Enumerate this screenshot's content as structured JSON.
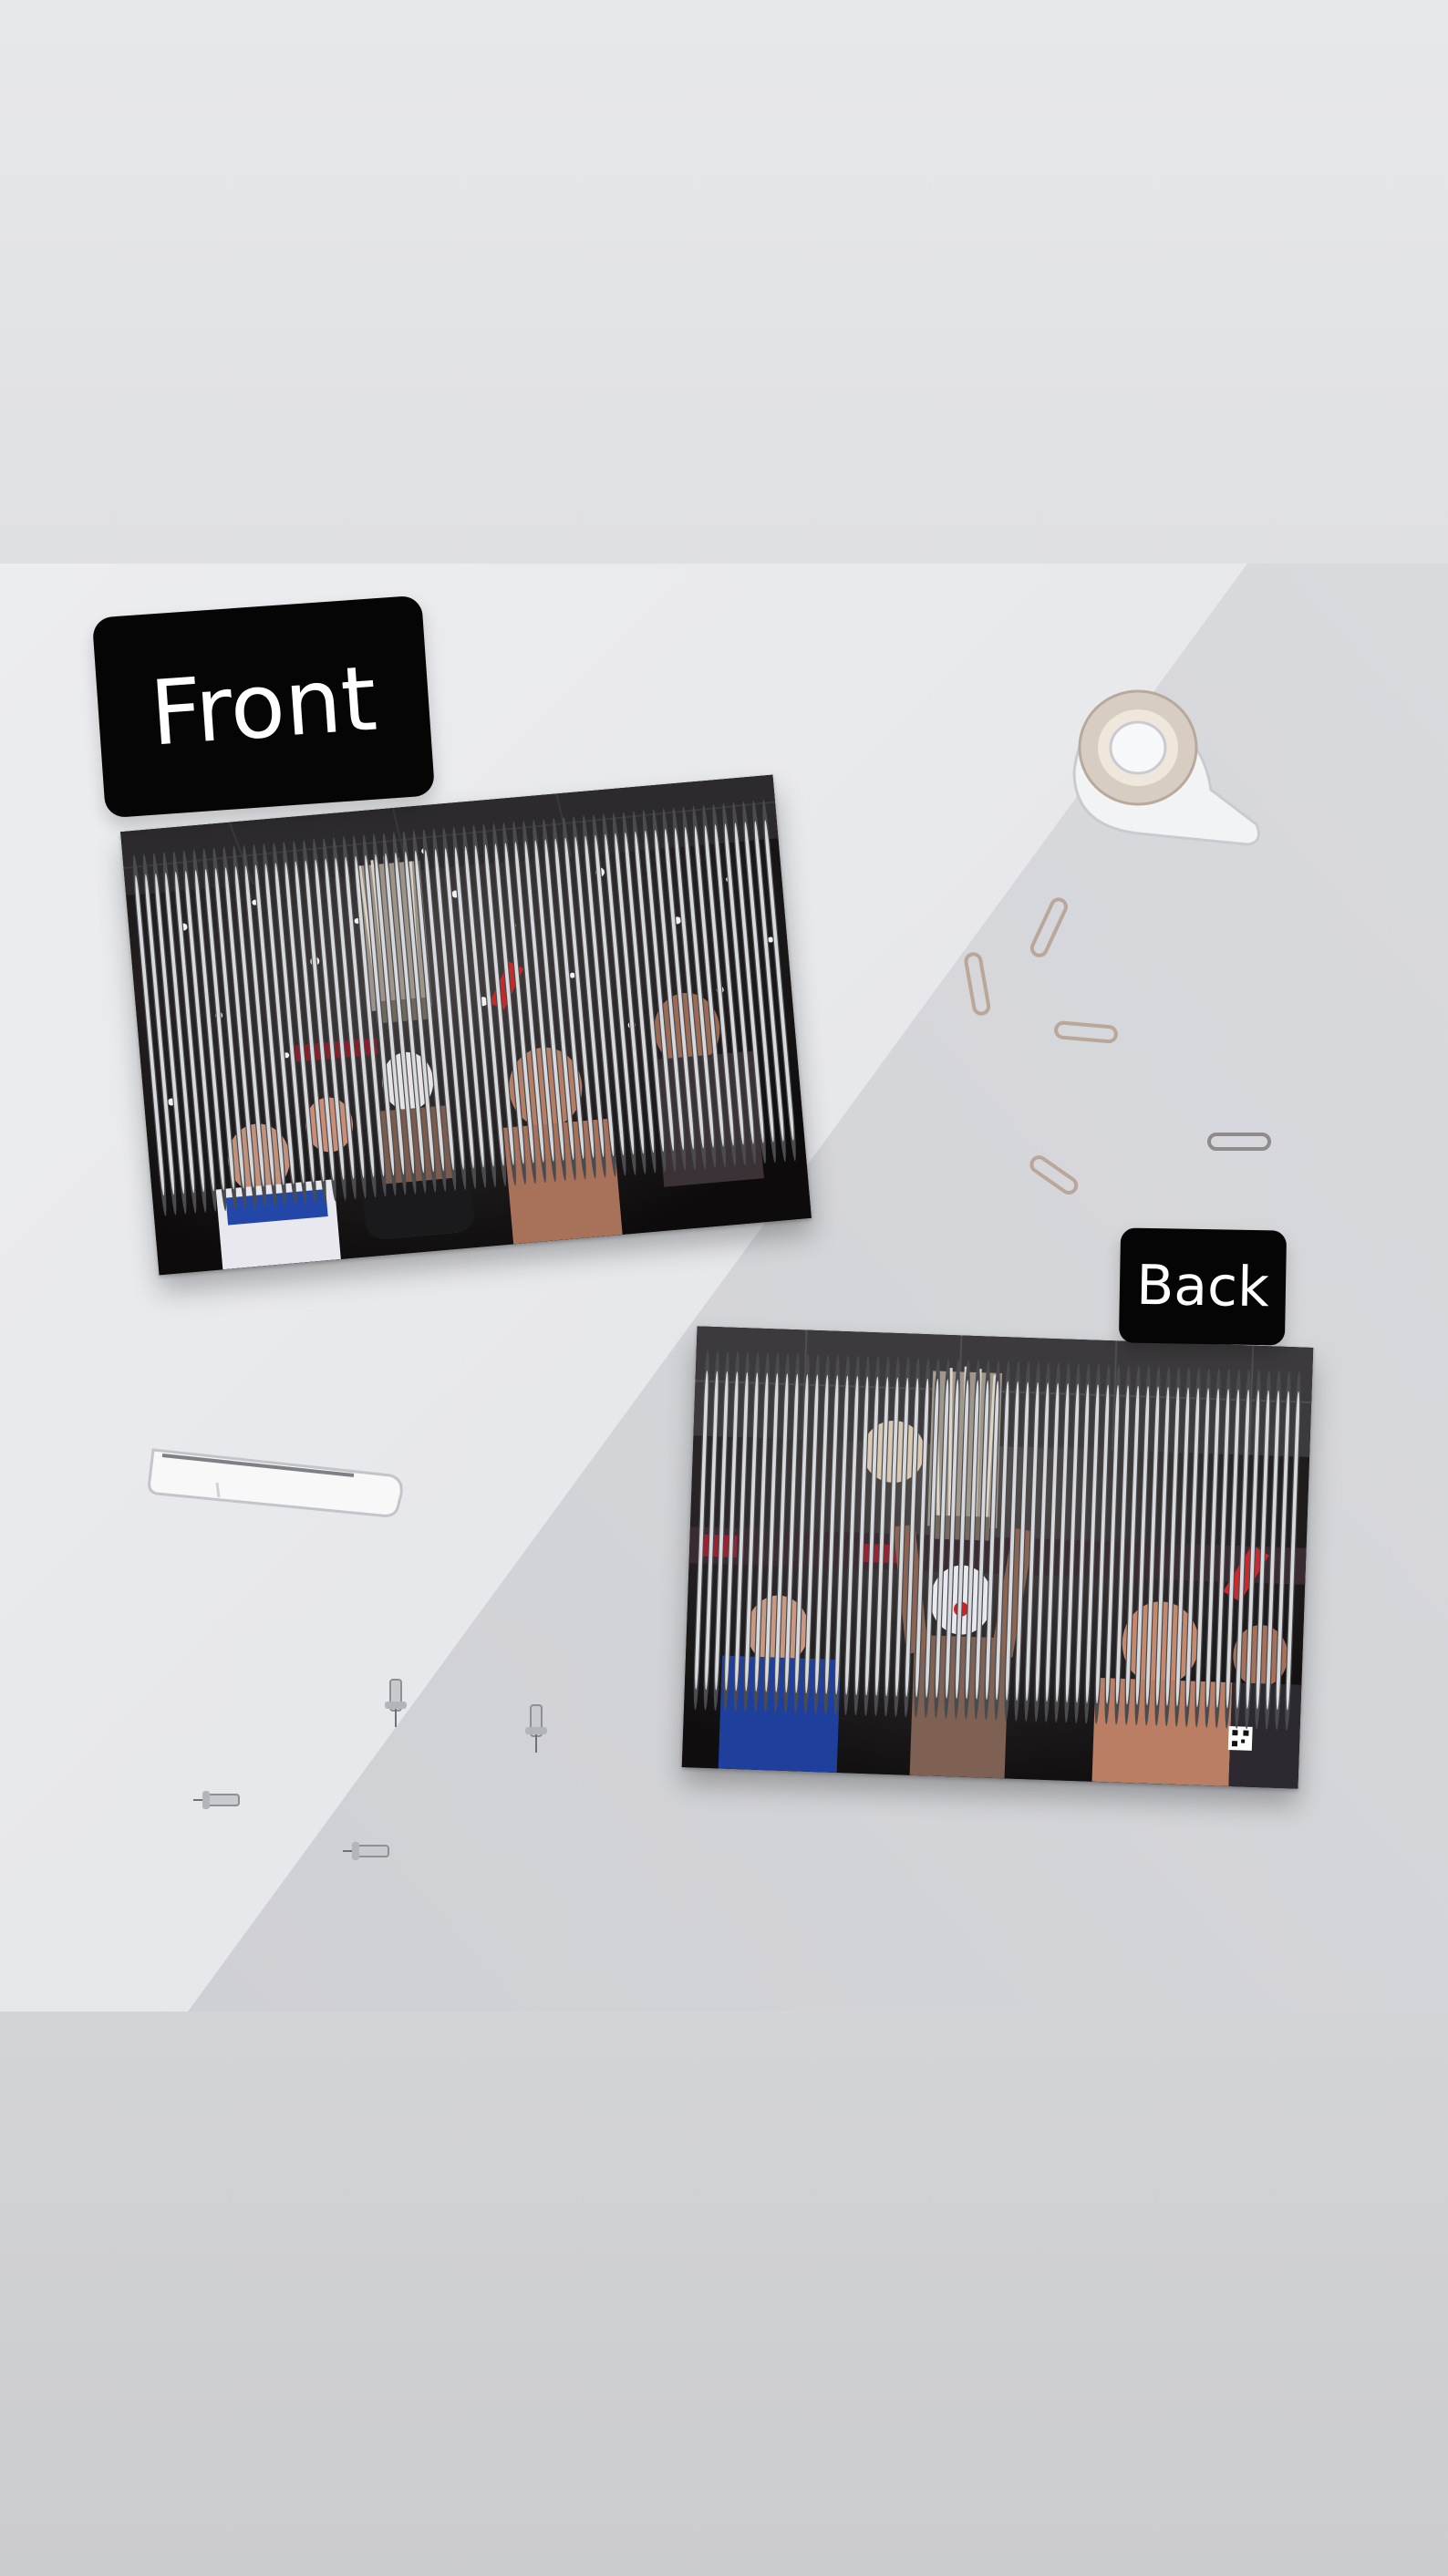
{
  "labels": {
    "front": "Front",
    "back": "Back"
  },
  "colors": {
    "label_bg": "#050505",
    "label_text": "#ffffff",
    "background_light": "#e6e7ea",
    "background_shadow": "#d2d3d8"
  },
  "objects": {
    "tape_dispenser": "tape-dispenser-icon",
    "paper_clips": "paper-clip-icon",
    "binder_clip": "clip-icon",
    "push_pins": "push-pin-icon"
  }
}
